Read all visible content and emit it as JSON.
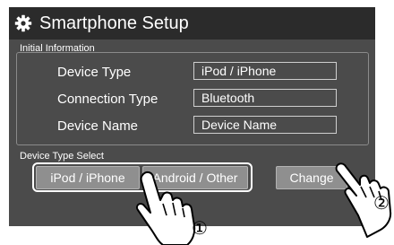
{
  "header": {
    "title": "Smartphone Setup",
    "icon": "gear-icon"
  },
  "initial_information": {
    "section_label": "Initial Information",
    "rows": [
      {
        "label": "Device Type",
        "value": "iPod / iPhone"
      },
      {
        "label": "Connection Type",
        "value": "Bluetooth"
      },
      {
        "label": "Device Name",
        "value": "Device Name"
      }
    ]
  },
  "device_type_select": {
    "section_label": "Device Type Select",
    "options": [
      {
        "label": "iPod / iPhone"
      },
      {
        "label": "Android / Other"
      }
    ],
    "change_label": "Change"
  },
  "callouts": [
    {
      "marker": "①"
    },
    {
      "marker": "②"
    }
  ],
  "colors": {
    "panel": "#4b4b4b",
    "title_bar": "#2b2b2b",
    "button": "#8f8f8f"
  }
}
